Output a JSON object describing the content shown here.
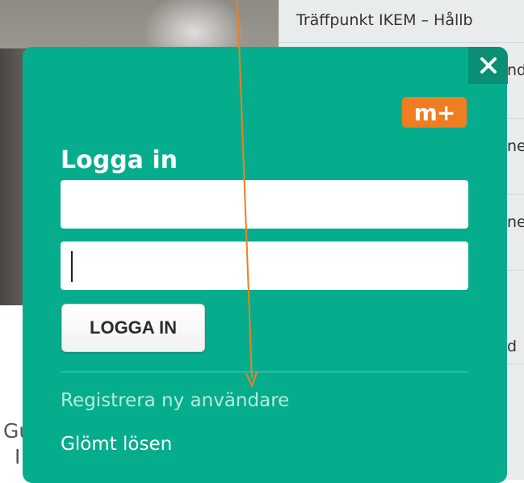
{
  "background": {
    "right_title": "Träffpunkt IKEM – Hållb",
    "right_fragments": [
      "nd",
      "ne",
      "ne",
      "d"
    ],
    "left_fragments": [
      "Gu",
      "I"
    ]
  },
  "dialog": {
    "close_glyph": "✕",
    "brand": "m+",
    "heading": "Logga in",
    "username": {
      "value": "",
      "placeholder": ""
    },
    "password": {
      "value": "",
      "placeholder": ""
    },
    "login_button": "LOGGA IN",
    "register_link": "Registrera ny användare",
    "forgot_link": "Glömt lösen"
  },
  "colors": {
    "dialog_bg": "#06ad8d",
    "close_bg": "#0a8f74",
    "brand_bg": "#ef7d22",
    "register_link": "#b7ebdd",
    "annotation_arrow": "#f07f1f"
  },
  "icons": {
    "close": "close-icon",
    "brand": "brand-logo",
    "annotation": "arrow-annotation"
  }
}
